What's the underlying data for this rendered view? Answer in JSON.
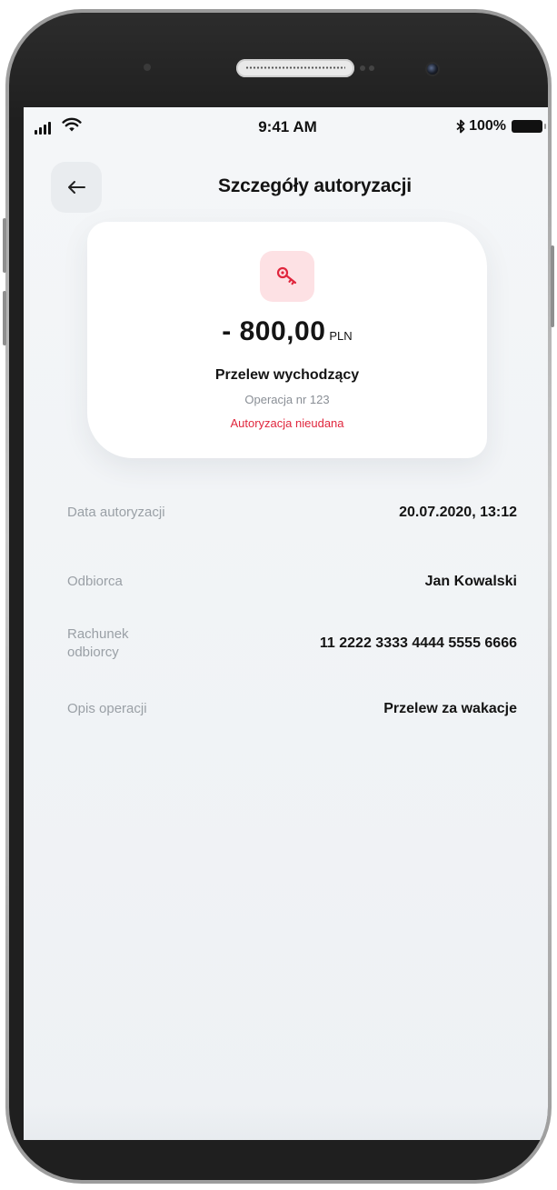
{
  "status_bar": {
    "time": "9:41 AM",
    "battery": "100%"
  },
  "header": {
    "back_icon": "arrow-left-icon",
    "title": "Szczegóły autoryzacji"
  },
  "summary": {
    "icon": "key-icon",
    "amount": "- 800,00",
    "currency": "PLN",
    "transfer_type": "Przelew wychodzący",
    "operation_number": "Operacja nr 123",
    "status": "Autoryzacja nieudana"
  },
  "details": [
    {
      "label": "Data autoryzacji",
      "value": "20.07.2020, 13:12"
    },
    {
      "label": "Odbiorca",
      "value": "Jan Kowalski"
    },
    {
      "label": "Rachunek odbiorcy",
      "value": "11 2222 3333 4444 5555 6666"
    },
    {
      "label": "Opis operacji",
      "value": "Przelew za wakacje"
    }
  ],
  "colors": {
    "error": "#e0263d",
    "icon_bg": "#fde1e4",
    "background": "#f2f4f6"
  }
}
